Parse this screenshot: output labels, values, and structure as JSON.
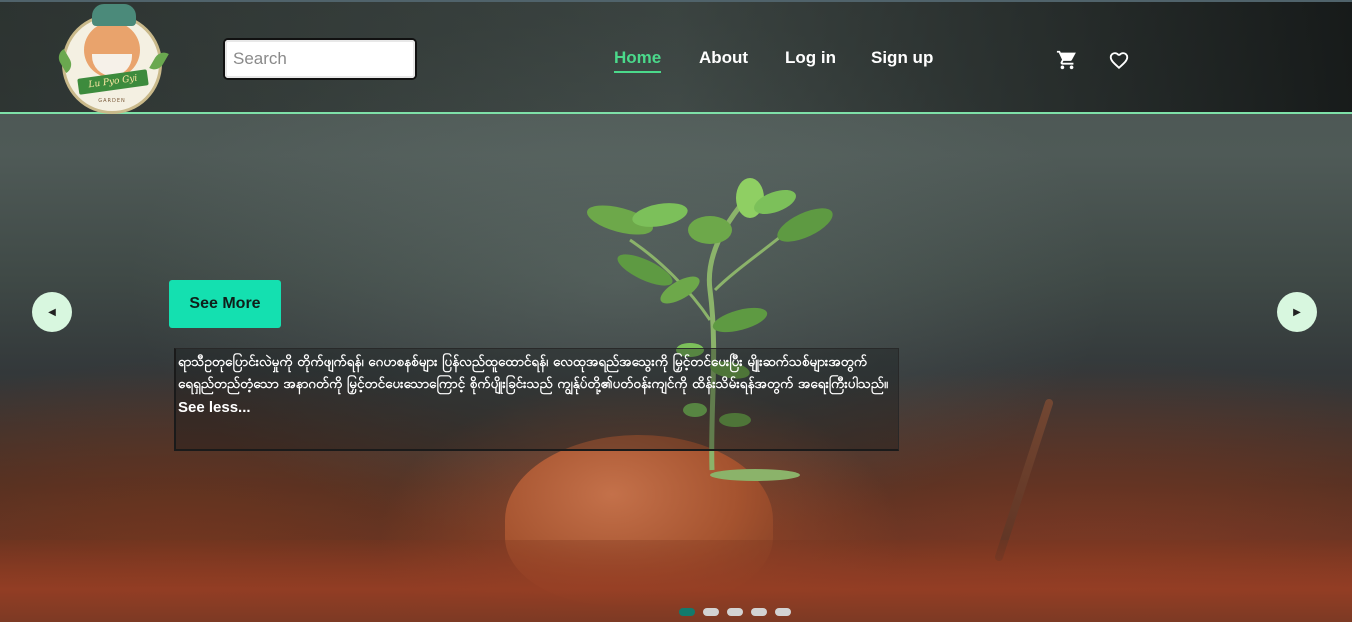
{
  "brand": {
    "logo_text": "Lu Pyo Gyi",
    "logo_subtext": "GARDEN"
  },
  "search": {
    "placeholder": "Search",
    "value": ""
  },
  "nav": {
    "items": [
      {
        "label": "Home",
        "active": true
      },
      {
        "label": "About",
        "active": false
      },
      {
        "label": "Log in",
        "active": false
      },
      {
        "label": "Sign up",
        "active": false
      }
    ]
  },
  "header_icons": [
    "cart-icon",
    "heart-icon"
  ],
  "hero": {
    "see_more_label": "See More",
    "caption": "ရာသီဥတုပြောင်းလဲမှုကို တိုက်ဖျက်ရန်၊ ဂေဟစနစ်များ ပြန်လည်ထူထောင်ရန်၊ လေထုအရည်အသွေးကို မြှင့်တင်ပေးပြီး မျိုးဆက်သစ်များအတွက် ရေရှည်တည်တံ့သော အနာဂတ်ကို မြှင့်တင်ပေးသောကြောင့် စိုက်ပျိုးခြင်းသည် ကျွန်ုပ်တို့၏ပတ်ဝန်းကျင်ကို ထိန်းသိမ်းရန်အတွက် အရေးကြီးပါသည်။",
    "see_less_label": "See less..."
  },
  "carousel": {
    "slide_count": 5,
    "active_index": 0
  },
  "colors": {
    "accent": "#4bd98b",
    "button_bg": "#14e0b0",
    "header_border": "#7ee0a8",
    "dot_active": "#137a6c"
  }
}
